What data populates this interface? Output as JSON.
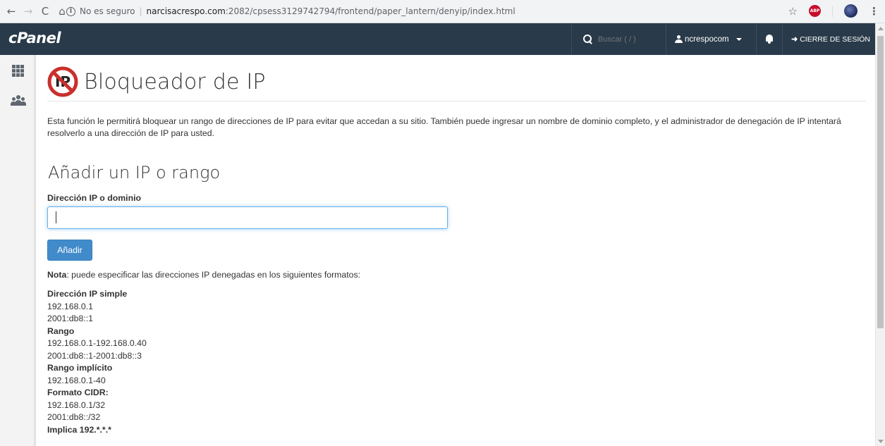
{
  "browser": {
    "back_label": "←",
    "forward_label": "→",
    "reload_label": "C",
    "home_label": "⌂",
    "security_text": "No es seguro",
    "url_host": "narcisacrespo.com",
    "url_rest": ":2082/cpsess3129742794/frontend/paper_lantern/denyip/index.html",
    "star_label": "☆",
    "abp_label": "ABP",
    "menu_label": "⋮"
  },
  "header": {
    "logo": "cPanel",
    "search_placeholder": "Buscar ( / )",
    "username": "ncrespocom",
    "logout_label": "CIERRE DE SESIÓN",
    "logout_glyph": "➜"
  },
  "page": {
    "title": "Bloqueador de IP",
    "intro": "Esta función le permitirá bloquear un rango de direcciones de IP para evitar que accedan a su sitio. También puede ingresar un nombre de dominio completo, y el administrador de denegación de IP intentará resolverlo a una dirección de IP para usted.",
    "section_title": "Añadir un IP o rango",
    "field_label": "Dirección IP o dominio",
    "field_value": "",
    "add_button": "Añadir",
    "note_bold": "Nota",
    "note_text": ": puede especificar las direcciones IP denegadas en los siguientes formatos:",
    "formats": [
      {
        "heading": "Dirección IP simple",
        "examples": [
          "192.168.0.1",
          "2001:db8::1"
        ]
      },
      {
        "heading": "Rango",
        "examples": [
          "192.168.0.1-192.168.0.40",
          "2001:db8::1-2001:db8::3"
        ]
      },
      {
        "heading": "Rango implícito",
        "examples": [
          "192.168.0.1-40"
        ]
      },
      {
        "heading": "Formato CIDR:",
        "examples": [
          "192.168.0.1/32",
          "2001:db8::/32"
        ]
      },
      {
        "heading": "Implica 192.*.*.*",
        "examples": []
      }
    ]
  },
  "colors": {
    "header_bg": "#293a4a",
    "button_bg": "#428bca",
    "block_icon_red": "#c9302c"
  }
}
